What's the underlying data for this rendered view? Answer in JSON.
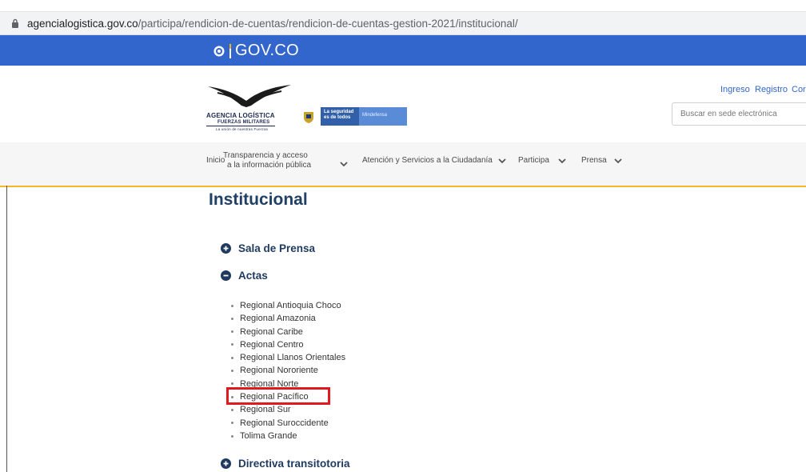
{
  "browser": {
    "url_domain": "agencialogistica.gov.co",
    "url_path": "/participa/rendicion-de-cuentas/rendicion-de-cuentas-gestion-2021/institucional/"
  },
  "govbar": {
    "logo_text": "GOV.CO"
  },
  "header": {
    "logo_name": "AGENCIA LOGÍSTICA",
    "logo_sub": "FUERZAS MILITARES",
    "logo_tagline": "La unión de nuestras Fuerzas",
    "seguridad_text": "La seguridad es de todos",
    "mindefensa_text": "Mindefensa",
    "links": [
      "Ingreso",
      "Registro",
      "Cor"
    ],
    "search_placeholder": "Buscar en sede electrónica"
  },
  "nav": {
    "items": [
      {
        "label": "Inicio"
      },
      {
        "label": "Transparencia y acceso",
        "label2": "a la información pública"
      },
      {
        "label": "Atención y Servicios a la Ciudadanía"
      },
      {
        "label": "Participa"
      },
      {
        "label": "Prensa"
      }
    ]
  },
  "main": {
    "title": "Institucional",
    "sections": [
      {
        "label": "Sala de Prensa",
        "state": "collapsed"
      },
      {
        "label": "Actas",
        "state": "expanded"
      },
      {
        "label": "Directiva transitotoria",
        "state": "collapsed"
      }
    ],
    "actas_items": [
      "Regional Antioquia Choco",
      "Regional Amazonia",
      "Regional Caribe",
      "Regional Centro",
      "Regional Llanos Orientales",
      "Regional Nororiente",
      "Regional Norte",
      "Regional Pacífico",
      "Regional Sur",
      "Regional Suroccidente",
      "Tolima Grande"
    ],
    "highlighted_item": "Regional Pacífico"
  },
  "colors": {
    "gov_blue": "#3366cc",
    "title_blue": "#204066",
    "nav_border": "#f3b822",
    "highlight_red": "#e0191f"
  }
}
